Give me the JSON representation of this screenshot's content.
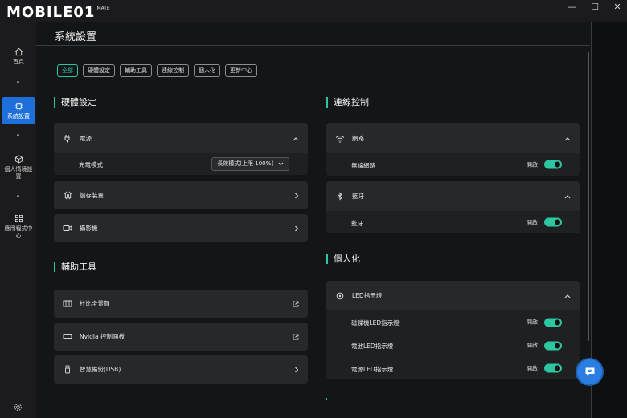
{
  "brand": {
    "logo_text": "MOBILE01",
    "logo_small": "MATE"
  },
  "window": {
    "minimize": "—",
    "maximize": "☐",
    "close": "✕"
  },
  "nav": [
    {
      "label": "首頁",
      "icon": "home-icon"
    },
    {
      "label": "系統設置",
      "icon": "chip-icon",
      "active": true
    },
    {
      "label": "個人情境設置",
      "icon": "cube-icon"
    },
    {
      "label": "應用程式中心",
      "icon": "grid-icon"
    }
  ],
  "page_title": "系統設置",
  "tabs": [
    "全部",
    "硬體設定",
    "輔助工具",
    "連線控制",
    "個人化",
    "更新中心"
  ],
  "hardware": {
    "title": "硬體設定",
    "power": {
      "label": "電源",
      "charge_label": "充電模式",
      "charge_value": "長效模式(上限 100%)"
    },
    "storage": {
      "label": "儲存裝置"
    },
    "camera": {
      "label": "攝影機"
    }
  },
  "assist": {
    "title": "輔助工具",
    "items": [
      {
        "label": "杜比全景聲",
        "icon": "dolby-icon"
      },
      {
        "label": "Nvidia 控制面板",
        "icon": "nvidia-icon"
      },
      {
        "label": "智慧備份(USB)",
        "icon": "usb-icon"
      }
    ]
  },
  "connect": {
    "title": "連線控制",
    "network": {
      "label": "網路",
      "sub_label": "無線網路",
      "state": "開啟"
    },
    "bluetooth": {
      "label": "藍牙",
      "sub_label": "藍牙",
      "state": "開啟"
    }
  },
  "personal": {
    "title": "個人化",
    "led": {
      "label": "LED指示燈",
      "items": [
        {
          "label": "磁碟機LED指示燈",
          "state": "開啟"
        },
        {
          "label": "電池LED指示燈",
          "state": "開啟"
        },
        {
          "label": "電源LED指示燈",
          "state": "開啟"
        }
      ]
    }
  },
  "colors": {
    "accent": "#2dc6a3",
    "nav_active": "#1e6fd9",
    "card": "#27282b"
  }
}
